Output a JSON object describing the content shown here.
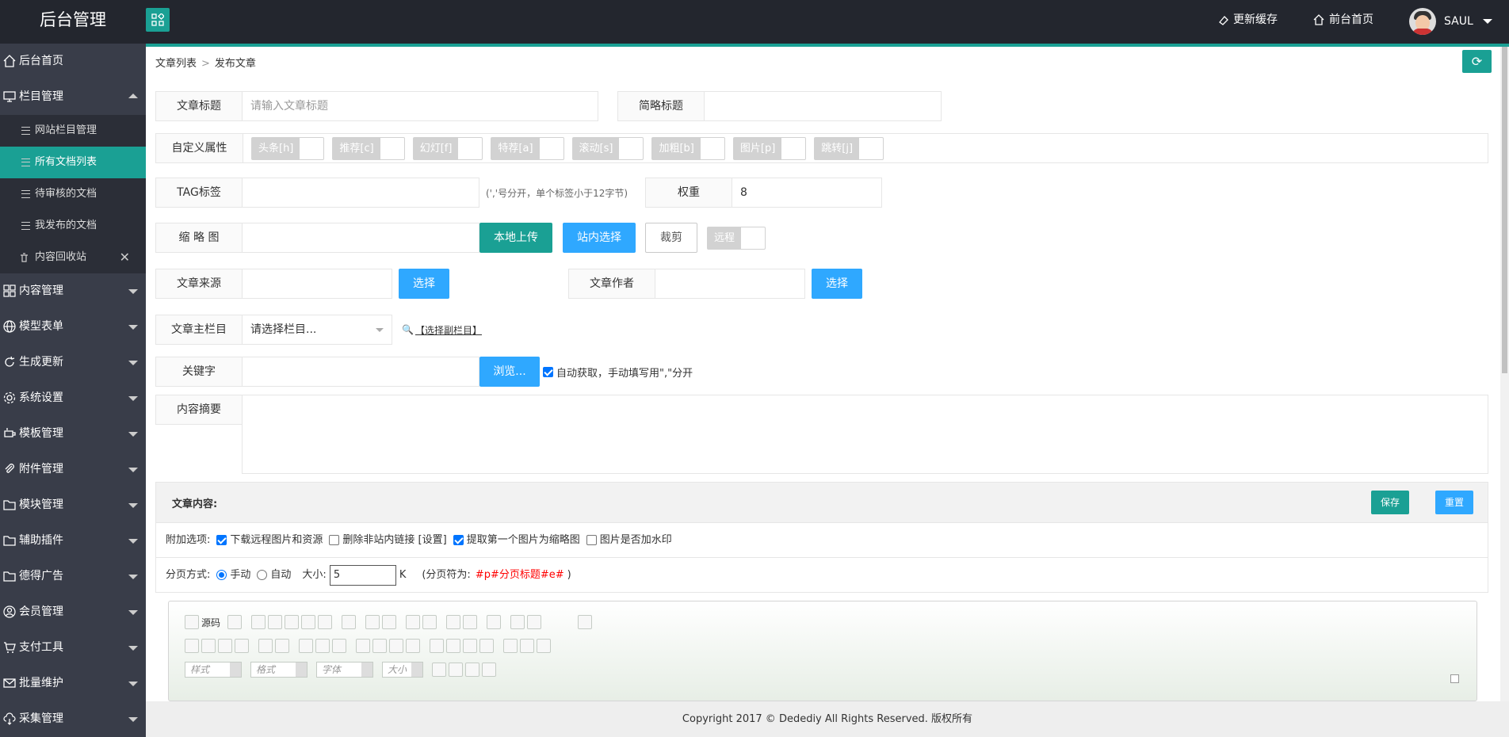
{
  "app": {
    "title": "后台管理",
    "header_links": [
      {
        "label": "更新缓存",
        "icon": "eraser-icon"
      },
      {
        "label": "前台首页",
        "icon": "home-icon"
      }
    ],
    "user": "SAUL"
  },
  "sidebar": {
    "home": "后台首页",
    "column_mgmt": "栏目管理",
    "sub_items": [
      "网站栏目管理",
      "所有文档列表",
      "待审核的文档",
      "我发布的文档",
      "内容回收站"
    ],
    "groups": [
      "内容管理",
      "模型表单",
      "生成更新",
      "系统设置",
      "模板管理",
      "附件管理",
      "模块管理",
      "辅助插件",
      "德得广告",
      "会员管理",
      "支付工具",
      "批量维护",
      "采集管理"
    ]
  },
  "breadcrumb": {
    "parent": "文章列表",
    "sep": ">",
    "current": "发布文章"
  },
  "form": {
    "title_label": "文章标题",
    "title_placeholder": "请输入文章标题",
    "short_title_label": "简略标题",
    "custom_attr_label": "自定义属性",
    "attrs": [
      "头条[h]",
      "推荐[c]",
      "幻灯[f]",
      "特荐[a]",
      "滚动[s]",
      "加粗[b]",
      "图片[p]",
      "跳转[j]"
    ],
    "tag_label": "TAG标签",
    "tag_hint": "(','号分开，单个标签小于12字节)",
    "weight_label": "权重",
    "weight_value": "8",
    "thumb_label": "缩 略 图",
    "upload_local": "本地上传",
    "site_select": "站内选择",
    "crop": "裁剪",
    "remote": "远程",
    "source_label": "文章来源",
    "choose": "选择",
    "author_label": "文章作者",
    "main_column_label": "文章主栏目",
    "main_column_value": "请选择栏目...",
    "sub_column_link": "【选择副栏目】",
    "keywords_label": "关键字",
    "browse": "浏览...",
    "auto_keywords": "自动获取，手动填写用\",\"分开",
    "summary_label": "内容摘要"
  },
  "content": {
    "heading": "文章内容:",
    "save": "保存",
    "reset": "重置",
    "options_label": "附加选项:",
    "options": [
      {
        "label": "下载远程图片和资源",
        "checked": true
      },
      {
        "label": "删除非站内链接 [设置]",
        "checked": false
      },
      {
        "label": "提取第一个图片为缩略图",
        "checked": true
      },
      {
        "label": "图片是否加水印",
        "checked": false
      }
    ],
    "paging_label": "分页方式:",
    "paging_manual": "手动",
    "paging_auto": "自动",
    "size_label": "大小:",
    "size_value": "5",
    "size_unit": "K",
    "paging_symbol_prefix": "(分页符为:",
    "paging_symbol": "#p#分页标题#e#",
    "paging_symbol_suffix": ")"
  },
  "editor": {
    "source_label": "源码",
    "combos": [
      "样式",
      "格式",
      "字体",
      "大小"
    ]
  },
  "footer": {
    "prefix": "Copyright 2017 © ",
    "brand": "Dedediy",
    "suffix": " All Rights Reserved. 版权所有"
  },
  "colors": {
    "accent": "#1aa094",
    "blue": "#2fa8ff",
    "sidebar": "#393d49",
    "topbar": "#23262e",
    "paging_symbol": "#ff0000"
  }
}
